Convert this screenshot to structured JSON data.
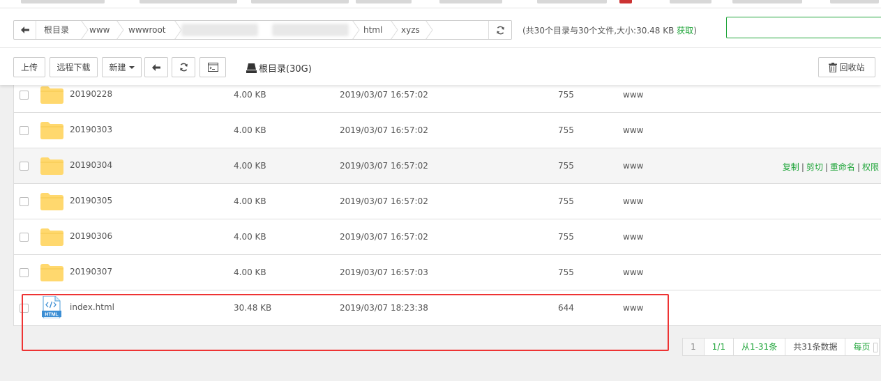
{
  "toolbar": {
    "breadcrumb": [
      "根目录",
      "www",
      "wwwroot",
      "html",
      "xyzs"
    ],
    "dir_info_prefix": "(共30个目录与30个文件,大小:30.48 KB ",
    "dir_info_link": "获取",
    "dir_info_suffix": ")",
    "search_value": "",
    "buttons": {
      "upload": "上传",
      "remote_download": "远程下载",
      "new": "新建",
      "recycle_bin": "回收站"
    },
    "root_disk": "根目录(30G)"
  },
  "files": [
    {
      "name": "20190228",
      "size": "4.00 KB",
      "mtime": "2019/03/07 16:57:02",
      "perm": "755",
      "owner": "www",
      "type": "folder"
    },
    {
      "name": "20190303",
      "size": "4.00 KB",
      "mtime": "2019/03/07 16:57:02",
      "perm": "755",
      "owner": "www",
      "type": "folder"
    },
    {
      "name": "20190304",
      "size": "4.00 KB",
      "mtime": "2019/03/07 16:57:02",
      "perm": "755",
      "owner": "www",
      "type": "folder"
    },
    {
      "name": "20190305",
      "size": "4.00 KB",
      "mtime": "2019/03/07 16:57:02",
      "perm": "755",
      "owner": "www",
      "type": "folder"
    },
    {
      "name": "20190306",
      "size": "4.00 KB",
      "mtime": "2019/03/07 16:57:02",
      "perm": "755",
      "owner": "www",
      "type": "folder"
    },
    {
      "name": "20190307",
      "size": "4.00 KB",
      "mtime": "2019/03/07 16:57:03",
      "perm": "755",
      "owner": "www",
      "type": "folder"
    },
    {
      "name": "index.html",
      "size": "30.48 KB",
      "mtime": "2019/03/07 18:23:38",
      "perm": "644",
      "owner": "www",
      "type": "html",
      "icon_label": "HTML"
    }
  ],
  "row_ops": [
    "复制",
    "剪切",
    "重命名",
    "权限"
  ],
  "row_ops_separator": "|",
  "pager": {
    "current_page": "1",
    "page_of": "1/1",
    "range": "从1-31条",
    "total": "共31条数据",
    "per_page": "每页"
  },
  "colors": {
    "accent": "#20a53a",
    "folder": "#ffd86e",
    "highlight": "#e33333"
  }
}
